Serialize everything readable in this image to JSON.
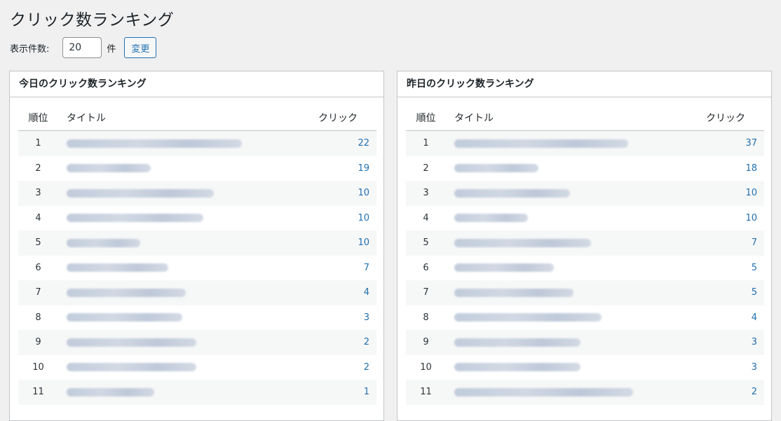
{
  "page": {
    "title": "クリック数ランキング"
  },
  "count_form": {
    "label": "表示件数:",
    "value": "20",
    "unit": "件",
    "button_label": "変更"
  },
  "colors": {
    "link": "#2271b1",
    "background": "#f0f0f1",
    "border": "#c3c4c7"
  },
  "panels": [
    {
      "title": "今日のクリック数ランキング",
      "headers": {
        "rank": "順位",
        "title": "タイトル",
        "click": "クリック"
      },
      "rows": [
        {
          "rank": "1",
          "click": "22"
        },
        {
          "rank": "2",
          "click": "19"
        },
        {
          "rank": "3",
          "click": "10"
        },
        {
          "rank": "4",
          "click": "10"
        },
        {
          "rank": "5",
          "click": "10"
        },
        {
          "rank": "6",
          "click": "7"
        },
        {
          "rank": "7",
          "click": "4"
        },
        {
          "rank": "8",
          "click": "3"
        },
        {
          "rank": "9",
          "click": "2"
        },
        {
          "rank": "10",
          "click": "2"
        },
        {
          "rank": "11",
          "click": "1"
        }
      ]
    },
    {
      "title": "昨日のクリック数ランキング",
      "headers": {
        "rank": "順位",
        "title": "タイトル",
        "click": "クリック"
      },
      "rows": [
        {
          "rank": "1",
          "click": "37"
        },
        {
          "rank": "2",
          "click": "18"
        },
        {
          "rank": "3",
          "click": "10"
        },
        {
          "rank": "4",
          "click": "10"
        },
        {
          "rank": "5",
          "click": "7"
        },
        {
          "rank": "6",
          "click": "5"
        },
        {
          "rank": "7",
          "click": "5"
        },
        {
          "rank": "8",
          "click": "4"
        },
        {
          "rank": "9",
          "click": "3"
        },
        {
          "rank": "10",
          "click": "3"
        },
        {
          "rank": "11",
          "click": "2"
        }
      ]
    }
  ]
}
